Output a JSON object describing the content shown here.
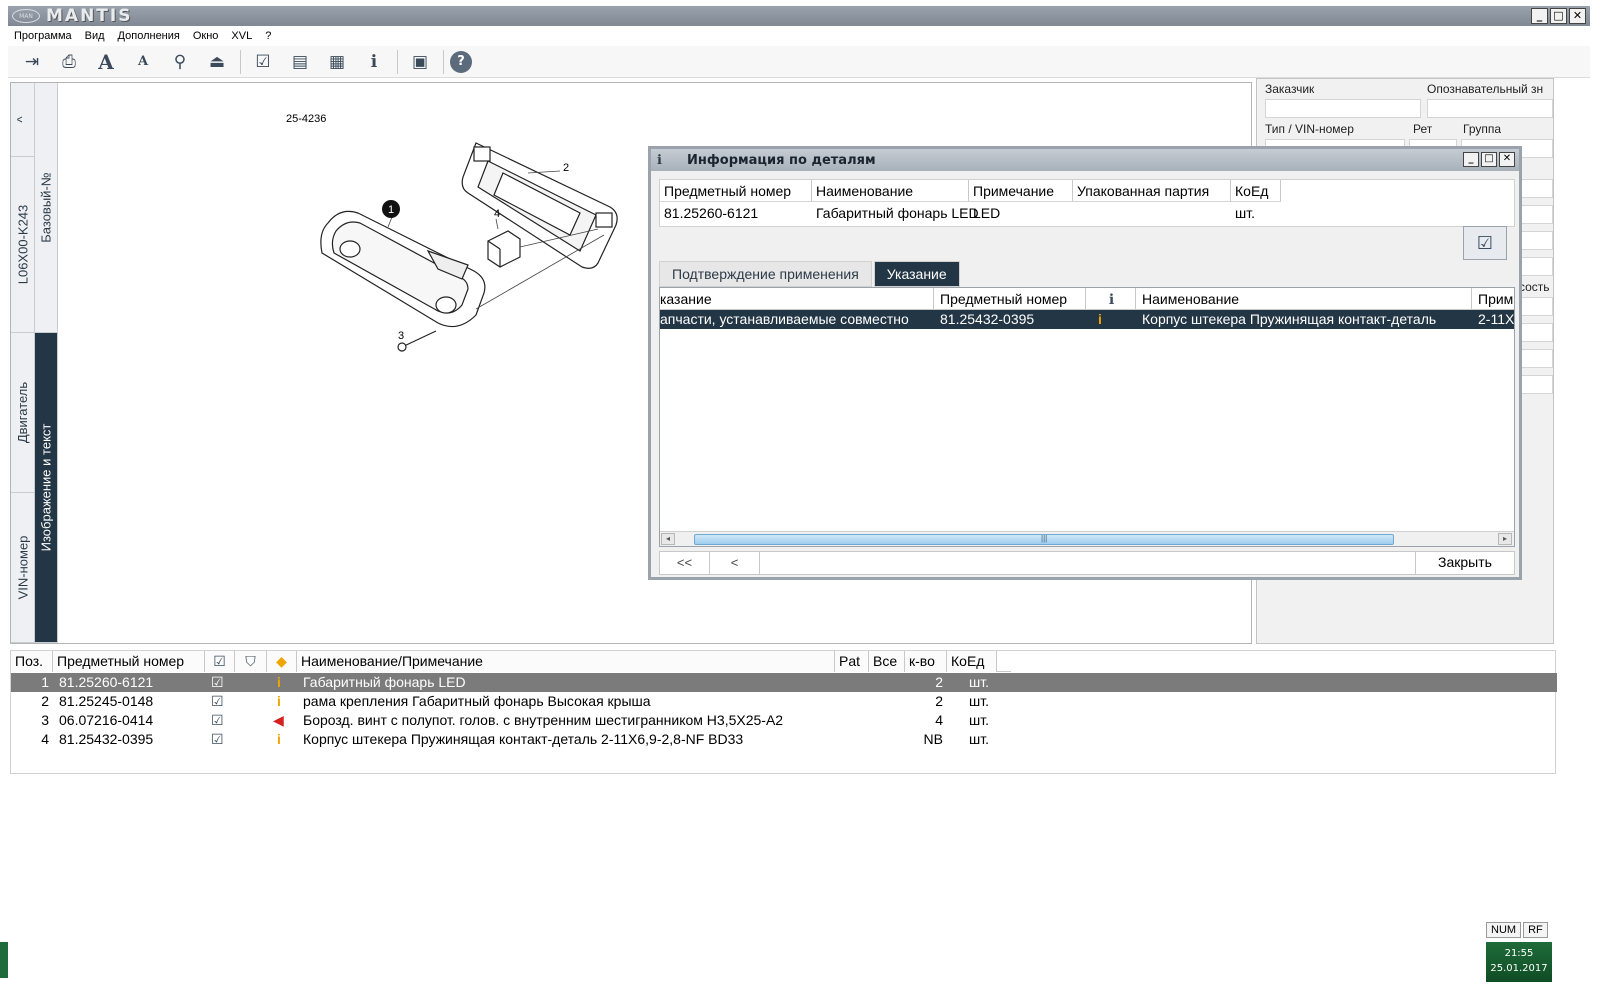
{
  "app": {
    "title": "MANTIS",
    "logo_badge": "MAN",
    "window_controls": [
      "_",
      "□",
      "✕"
    ]
  },
  "menu": {
    "items": [
      "Программа",
      "Вид",
      "Дополнения",
      "Окно",
      "XVL",
      "?"
    ]
  },
  "toolbar": {
    "buttons": [
      {
        "icon": "exit-icon",
        "glyph": "⇥"
      },
      {
        "icon": "printer-icon",
        "glyph": "⎙"
      },
      {
        "icon": "font-large-icon",
        "glyph": "A"
      },
      {
        "icon": "font-small-icon",
        "glyph": "A"
      },
      {
        "icon": "zoom-icon",
        "glyph": "⚲"
      },
      {
        "icon": "stamp-icon",
        "glyph": "⏏"
      },
      {
        "icon": "checklist-icon",
        "glyph": "☑"
      },
      {
        "icon": "document-icon",
        "glyph": "▤"
      },
      {
        "icon": "catalog-icon",
        "glyph": "▦"
      },
      {
        "icon": "part-info-icon",
        "glyph": "ℹ"
      },
      {
        "icon": "fullscreen-icon",
        "glyph": "▣"
      },
      {
        "icon": "help-icon",
        "glyph": "?"
      }
    ]
  },
  "left_tabs": {
    "up_arrow": "^",
    "model": "L06X00-K243",
    "base_no": "Базовый-№",
    "engine": "Двигатель",
    "vin": "VIN-номер",
    "image_text": "Изображение и текст"
  },
  "drawing": {
    "id": "25-4236",
    "callouts": [
      "1",
      "2",
      "3",
      "4"
    ]
  },
  "right_panel": {
    "customer_label": "Заказчик",
    "identifier_label": "Опознавательный зн",
    "type_vin_label": "Тип / VIN-номер",
    "ret_label": "Рет",
    "group_label": "Группа",
    "partial_label": "сость"
  },
  "parts_table": {
    "headers": {
      "pos": "Поз.",
      "part_no": "Предметный номер",
      "name": "Наименование/Примечание",
      "pat": "Pat",
      "all": "Все",
      "qty": "к-во",
      "unit": "КоЕд"
    },
    "header_icons": [
      "check-column-icon",
      "filter-column-icon",
      "info-arrows-column-icon"
    ],
    "rows": [
      {
        "pos": "1",
        "part_no": "81.25260-6121",
        "name": "Габаритный фонарь LED",
        "qty": "2",
        "unit": "шт.",
        "info": "info-marker-icon"
      },
      {
        "pos": "2",
        "part_no": "81.25245-0148",
        "name": "рама крепления Габаритный фонарь Высокая крыша",
        "qty": "2",
        "unit": "шт.",
        "info": "info-marker-icon"
      },
      {
        "pos": "3",
        "part_no": "06.07216-0414",
        "name": "Борозд. винт с полупот. голов. с внутренним шестигранником Н3,5Х25-А2",
        "qty": "4",
        "unit": "шт.",
        "info": "arrow-left-marker-icon"
      },
      {
        "pos": "4",
        "part_no": "81.25432-0395",
        "name": "Корпус штекера Пружинящая контакт-деталь 2-11Х6,9-2,8-NF BD33",
        "qty": "NB",
        "unit": "шт.",
        "info": "info-marker-icon"
      }
    ]
  },
  "dialog": {
    "title": "Информация по деталям",
    "headers": {
      "part_no": "Предметный номер",
      "name": "Наименование",
      "note": "Примечание",
      "package": "Упакованная партия",
      "unit": "КоЕд"
    },
    "values": {
      "part_no": "81.25260-6121",
      "name": "Габаритный фонарь LED",
      "note": "LED",
      "package": "",
      "unit": "шт."
    },
    "tabs": {
      "confirm": "Подтверждение применения",
      "hint": "Указание"
    },
    "grid_headers": {
      "hint": "казание",
      "part_no": "Предметный номер",
      "name": "Наименование",
      "note": "Прим"
    },
    "grid_row": {
      "hint": "апчасти, устанавливаемые совместно",
      "part_no": "81.25432-0395",
      "name": "Корпус штекера Пружинящая контакт-деталь",
      "note": "2-11Х"
    },
    "nav": {
      "first": "<<",
      "prev": "<"
    },
    "close_label": "Закрыть",
    "scroll_left": "◂",
    "scroll_right": "▸",
    "scroll_grip": "|||"
  },
  "status": {
    "num": "NUM",
    "rf": "RF",
    "time": "21:55",
    "date": "25.01.2017"
  },
  "colors": {
    "dark_tab": "#233646",
    "title_bar": "#8a939d",
    "selected_row": "#7b7b7b",
    "info_marker": "#f0a400",
    "arrow_marker": "#d62020"
  }
}
